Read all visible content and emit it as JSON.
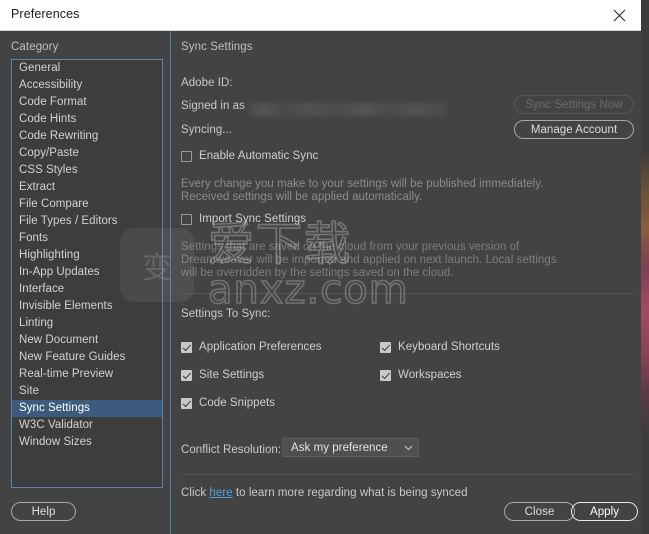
{
  "window": {
    "title": "Preferences",
    "close_icon": "close-icon"
  },
  "columns": {
    "category_label": "Category",
    "pane_label": "Sync Settings"
  },
  "sidebar": {
    "selected": "Sync Settings",
    "items": [
      {
        "label": "General"
      },
      {
        "label": "Accessibility"
      },
      {
        "label": "Code Format"
      },
      {
        "label": "Code Hints"
      },
      {
        "label": "Code Rewriting"
      },
      {
        "label": "Copy/Paste"
      },
      {
        "label": "CSS Styles"
      },
      {
        "label": "Extract"
      },
      {
        "label": "File Compare"
      },
      {
        "label": "File Types / Editors"
      },
      {
        "label": "Fonts"
      },
      {
        "label": "Highlighting"
      },
      {
        "label": "In-App Updates"
      },
      {
        "label": "Interface"
      },
      {
        "label": "Invisible Elements"
      },
      {
        "label": "Linting"
      },
      {
        "label": "New Document"
      },
      {
        "label": "New Feature Guides"
      },
      {
        "label": "Real-time Preview"
      },
      {
        "label": "Site"
      },
      {
        "label": "Sync Settings"
      },
      {
        "label": "W3C Validator"
      },
      {
        "label": "Window Sizes"
      }
    ]
  },
  "pane": {
    "adobe_id_label": "Adobe ID:",
    "signed_in_label": "Signed in as",
    "signed_in_value": "",
    "syncing_status": "Syncing...",
    "sync_now_button": "Sync Settings Now",
    "manage_account_button": "Manage Account",
    "enable_auto_sync": {
      "label": "Enable Automatic Sync",
      "checked": false
    },
    "auto_sync_help_line1": "Every change you make to your settings will be published immediately.",
    "auto_sync_help_line2": "Received settings will be applied automatically.",
    "import_sync_settings": {
      "label": "Import Sync Settings",
      "checked": false
    },
    "import_help_line1": "Settings that are saved on the cloud from your previous version of",
    "import_help_line2": "Dreamweaver will be imported and applied on next launch. Local settings",
    "import_help_line3": "will be overridden by the settings saved on the cloud.",
    "settings_to_sync_label": "Settings To Sync:",
    "sync_items": [
      {
        "label": "Application Preferences",
        "checked": true
      },
      {
        "label": "Keyboard Shortcuts",
        "checked": true
      },
      {
        "label": "Site Settings",
        "checked": true
      },
      {
        "label": "Workspaces",
        "checked": true
      },
      {
        "label": "Code Snippets",
        "checked": true
      }
    ],
    "conflict_resolution_label": "Conflict Resolution:",
    "conflict_resolution_value": "Ask my preference",
    "conflict_resolution_options": [
      "Ask my preference"
    ],
    "learn_more_prefix": "Click ",
    "learn_more_link": "here",
    "learn_more_suffix": " to learn more regarding what is being synced"
  },
  "footer": {
    "help_button": "Help",
    "close_button": "Close",
    "apply_button": "Apply"
  },
  "watermark": {
    "badge_glyph": "变",
    "chinese_text": "爱下载",
    "url_text": "anxz.com"
  },
  "colors": {
    "dialog_bg": "#434343",
    "titlebar_bg": "#ffffff",
    "selection_blue": "#3b5c7d",
    "focus_border_blue": "#5b85b0",
    "link_blue": "#4e9ede"
  }
}
